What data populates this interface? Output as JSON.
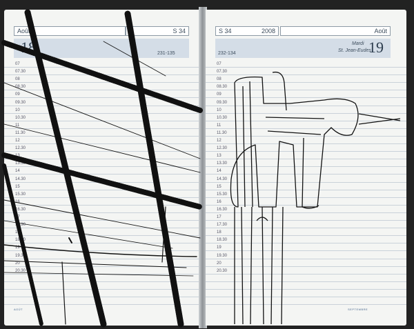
{
  "left_page": {
    "month": "Août",
    "week": "S 34",
    "day_number": "18",
    "day_count": "231-135"
  },
  "right_page": {
    "week": "S 34",
    "year": "2008",
    "month": "Août",
    "day_name": "Mardi",
    "saint": "St. Jean-Eudes",
    "day_number": "19",
    "day_count": "232-134"
  },
  "time_slots": [
    "07",
    "07.30",
    "08",
    "08.30",
    "09",
    "09.30",
    "10",
    "10.30",
    "11",
    "11.30",
    "12",
    "12.30",
    "13",
    "13.30",
    "14",
    "14.30",
    "15",
    "15.30",
    "16",
    "16.30",
    "17",
    "17.30",
    "18",
    "18.30",
    "19",
    "19.30",
    "20",
    "20.30"
  ],
  "mini_calendar": {
    "left_label": "AOÛT",
    "right_label": "SEPTEMBRE"
  },
  "colors": {
    "paper": "#f4f5f3",
    "header_band": "#d4dde7",
    "ink": "#111111",
    "rule_lines": "#c9d1d9"
  }
}
